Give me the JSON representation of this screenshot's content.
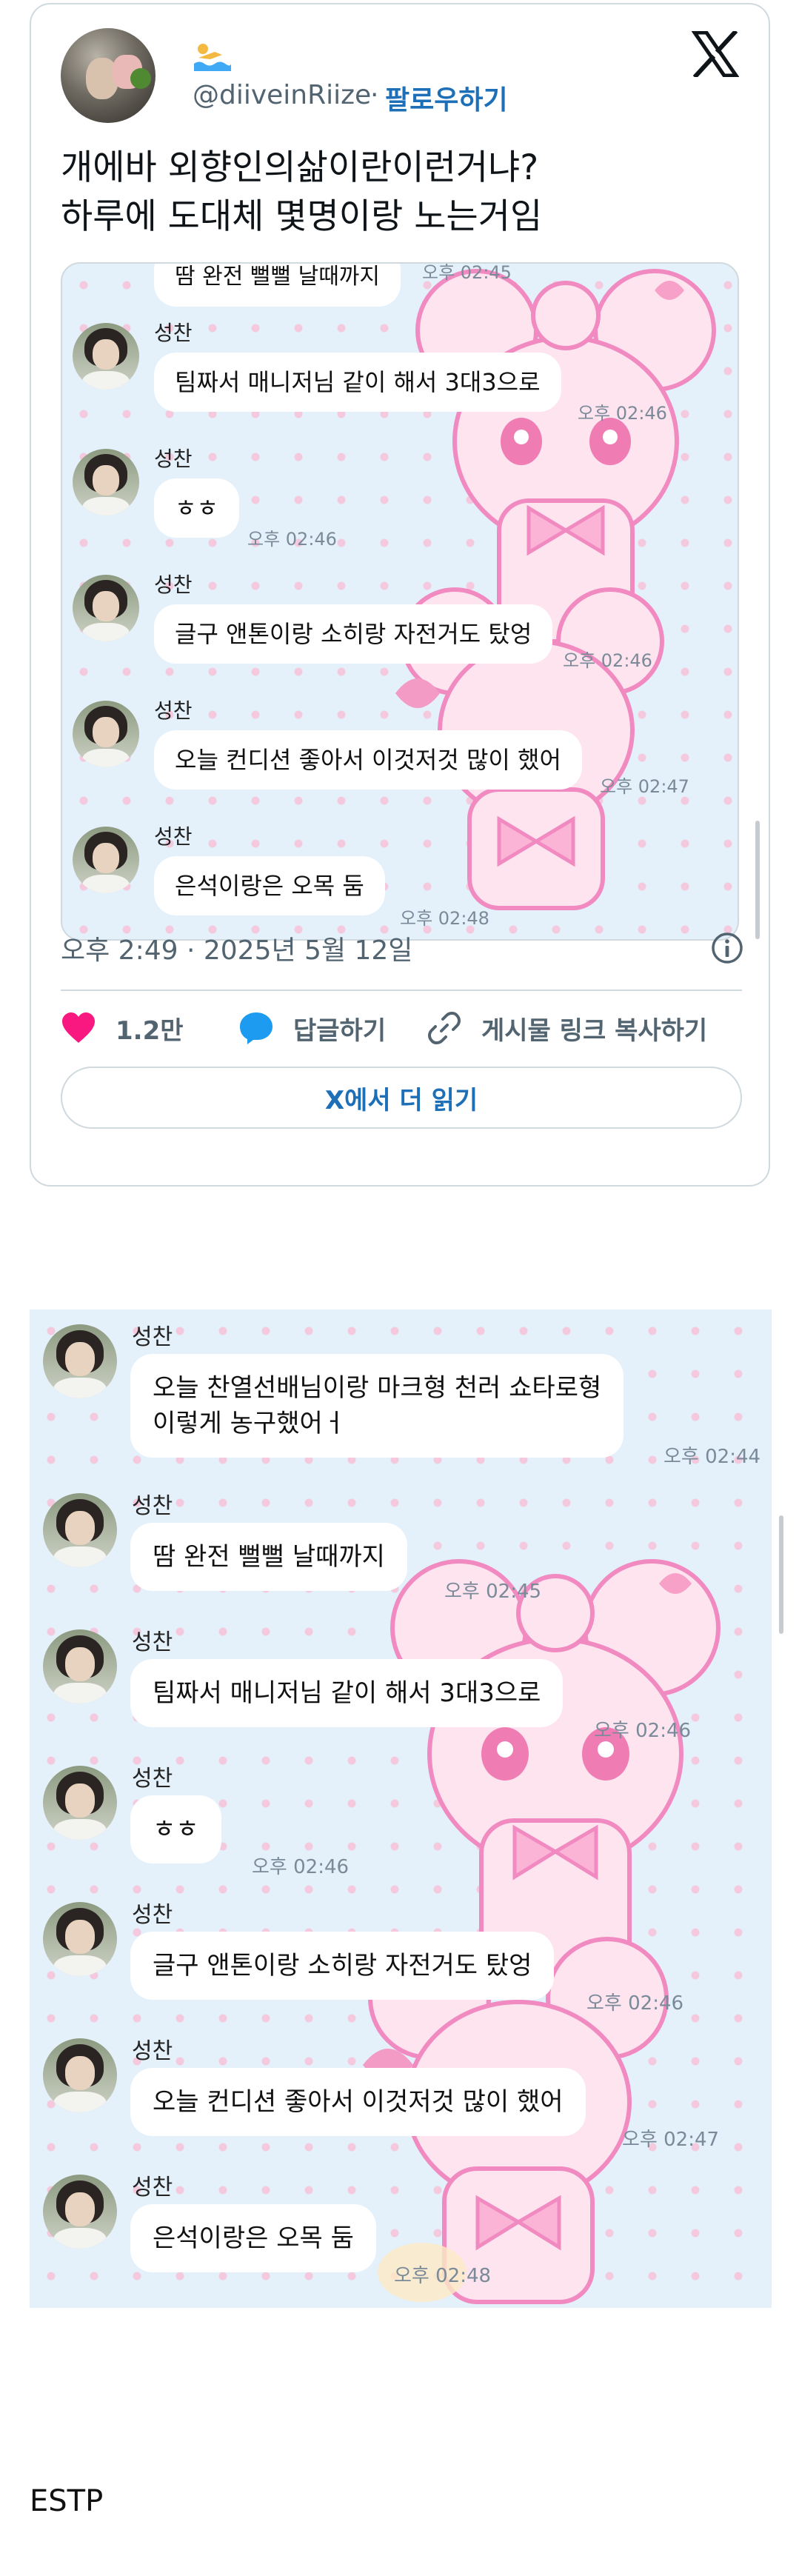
{
  "tweet": {
    "handle": "@diiveinRiize",
    "separator": "·",
    "follow_label": "팔로우하기",
    "text": "개에바 외향인의삶이란이런거냐?\n하루에 도대체 몇명이랑 노는거임",
    "timestamp": "오후 2:49 · 2025년 5월 12일",
    "likes_count": "1.2만",
    "reply_label": "답글하기",
    "copy_link_label": "게시물 링크 복사하기",
    "read_more_label": "X에서 더 읽기",
    "icons": [
      "swimmer-emoji-icon",
      "x-logo-icon",
      "info-icon",
      "heart-icon",
      "reply-icon",
      "link-icon"
    ],
    "colors": {
      "like": "#f91880",
      "reply": "#1d9bf0",
      "link_blue": "#1d6fb8",
      "muted": "#536471"
    }
  },
  "chat_small": {
    "partial_top_text": "땀 완전 뻘뻘 날때까지",
    "partial_top_time": "오후 02:45",
    "messages": [
      {
        "sender": "성찬",
        "text": "팀짜서 매니저님 같이 해서 3대3으로",
        "time": "오후 02:46"
      },
      {
        "sender": "성찬",
        "text": "ㅎㅎ",
        "time": "오후 02:46"
      },
      {
        "sender": "성찬",
        "text": "글구 앤톤이랑 소히랑 자전거도 탔엉",
        "time": "오후 02:46"
      },
      {
        "sender": "성찬",
        "text": "오늘 컨디션 좋아서 이것저것 많이 했어",
        "time": "오후 02:47"
      },
      {
        "sender": "성찬",
        "text": "은석이랑은 오목 둠",
        "time": "오후 02:48"
      }
    ]
  },
  "chat_large": {
    "messages": [
      {
        "sender": "성찬",
        "text": "오늘 찬열선배님이랑 마크형 천러 쇼타로형\n이렇게 농구했어ㅓ",
        "time": "오후 02:44"
      },
      {
        "sender": "성찬",
        "text": "땀 완전 뻘뻘 날때까지",
        "time": "오후 02:45"
      },
      {
        "sender": "성찬",
        "text": "팀짜서 매니저님 같이 해서 3대3으로",
        "time": "오후 02:46"
      },
      {
        "sender": "성찬",
        "text": "ㅎㅎ",
        "time": "오후 02:46"
      },
      {
        "sender": "성찬",
        "text": "글구 앤톤이랑 소히랑 자전거도 탔엉",
        "time": "오후 02:46"
      },
      {
        "sender": "성찬",
        "text": "오늘 컨디션 좋아서 이것저것 많이 했어",
        "time": "오후 02:47"
      },
      {
        "sender": "성찬",
        "text": "은석이랑은 오목 둠",
        "time": "오후 02:48"
      }
    ]
  },
  "footer": {
    "text": "ESTP"
  }
}
